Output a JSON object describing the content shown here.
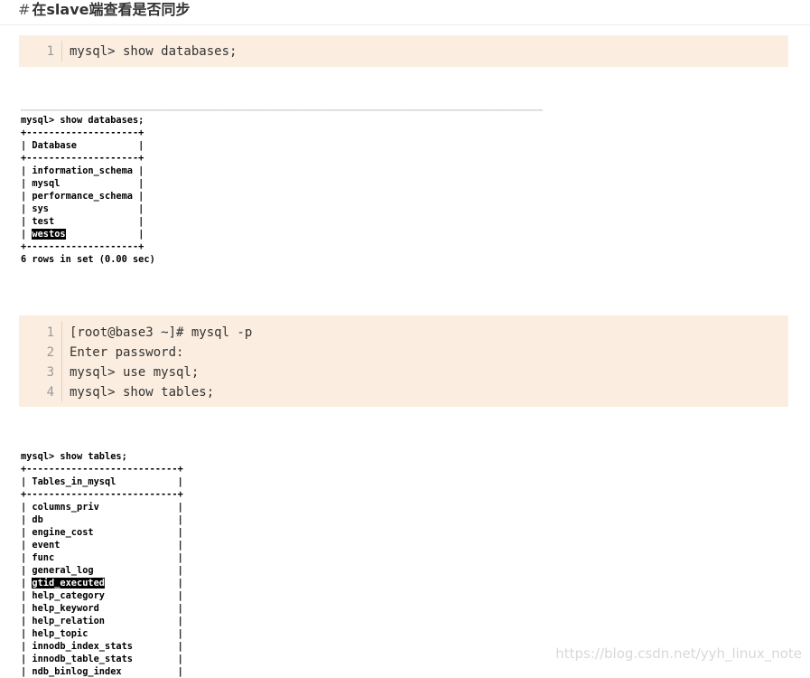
{
  "heading": {
    "hash": "#",
    "title": "在slave端查看是否同步"
  },
  "code_block_1": {
    "lines": [
      {
        "no": "1",
        "text": "mysql> show databases;"
      }
    ]
  },
  "terminal_1": {
    "lines": [
      "mysql> show databases;",
      "+--------------------+",
      "| Database           |",
      "+--------------------+",
      "| information_schema |",
      "| mysql              |",
      "| performance_schema |",
      "| sys                |",
      "| test               |",
      "| westos             |",
      "+--------------------+",
      "6 rows in set (0.00 sec)"
    ],
    "highlight": "westos"
  },
  "code_block_2": {
    "lines": [
      {
        "no": "1",
        "text": "[root@base3 ~]# mysql -p"
      },
      {
        "no": "2",
        "text": "Enter password:"
      },
      {
        "no": "3",
        "text": "mysql> use mysql;"
      },
      {
        "no": "4",
        "text": "mysql> show tables;"
      }
    ]
  },
  "terminal_2": {
    "lines": [
      "mysql> show tables;",
      "+---------------------------+",
      "| Tables_in_mysql           |",
      "+---------------------------+",
      "| columns_priv              |",
      "| db                        |",
      "| engine_cost               |",
      "| event                     |",
      "| func                      |",
      "| general_log               |",
      "| gtid_executed             |",
      "| help_category             |",
      "| help_keyword              |",
      "| help_relation             |",
      "| help_topic                |",
      "| innodb_index_stats        |",
      "| innodb_table_stats        |",
      "| ndb_binlog_index          |"
    ],
    "highlight": "gtid_executed"
  },
  "watermark": "https://blog.csdn.net/yyh_linux_note"
}
